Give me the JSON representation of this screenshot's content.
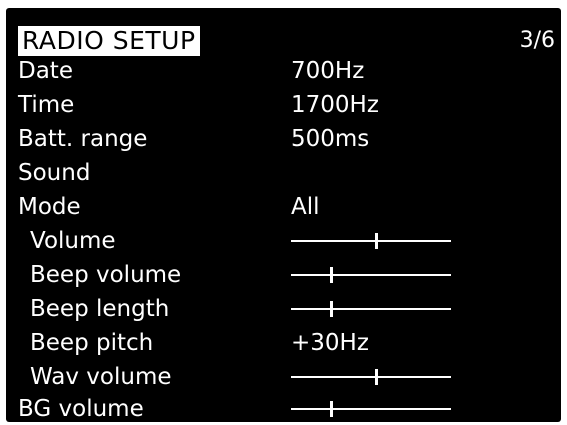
{
  "header": {
    "title": "RADIO SETUP",
    "page": "3/6"
  },
  "rows": [
    {
      "label": "Date",
      "value": "700Hz"
    },
    {
      "label": "Time",
      "value": "1700Hz"
    },
    {
      "label": "Batt. range",
      "value": "500ms"
    },
    {
      "label": "Sound",
      "value": ""
    },
    {
      "label": "Mode",
      "value": "All"
    },
    {
      "label": "Volume",
      "slider_level": 0.53
    },
    {
      "label": "Beep volume",
      "slider_level": 0.25
    },
    {
      "label": "Beep length",
      "slider_level": 0.25
    },
    {
      "label": "Beep pitch",
      "value": "+30Hz"
    },
    {
      "label": "Wav volume",
      "slider_level": 0.53
    },
    {
      "label": "BG volume",
      "slider_level": 0.25
    }
  ],
  "colors": {
    "screen_background": "#000000",
    "text": "#ffffff",
    "title_highlight": "#ffffff"
  }
}
